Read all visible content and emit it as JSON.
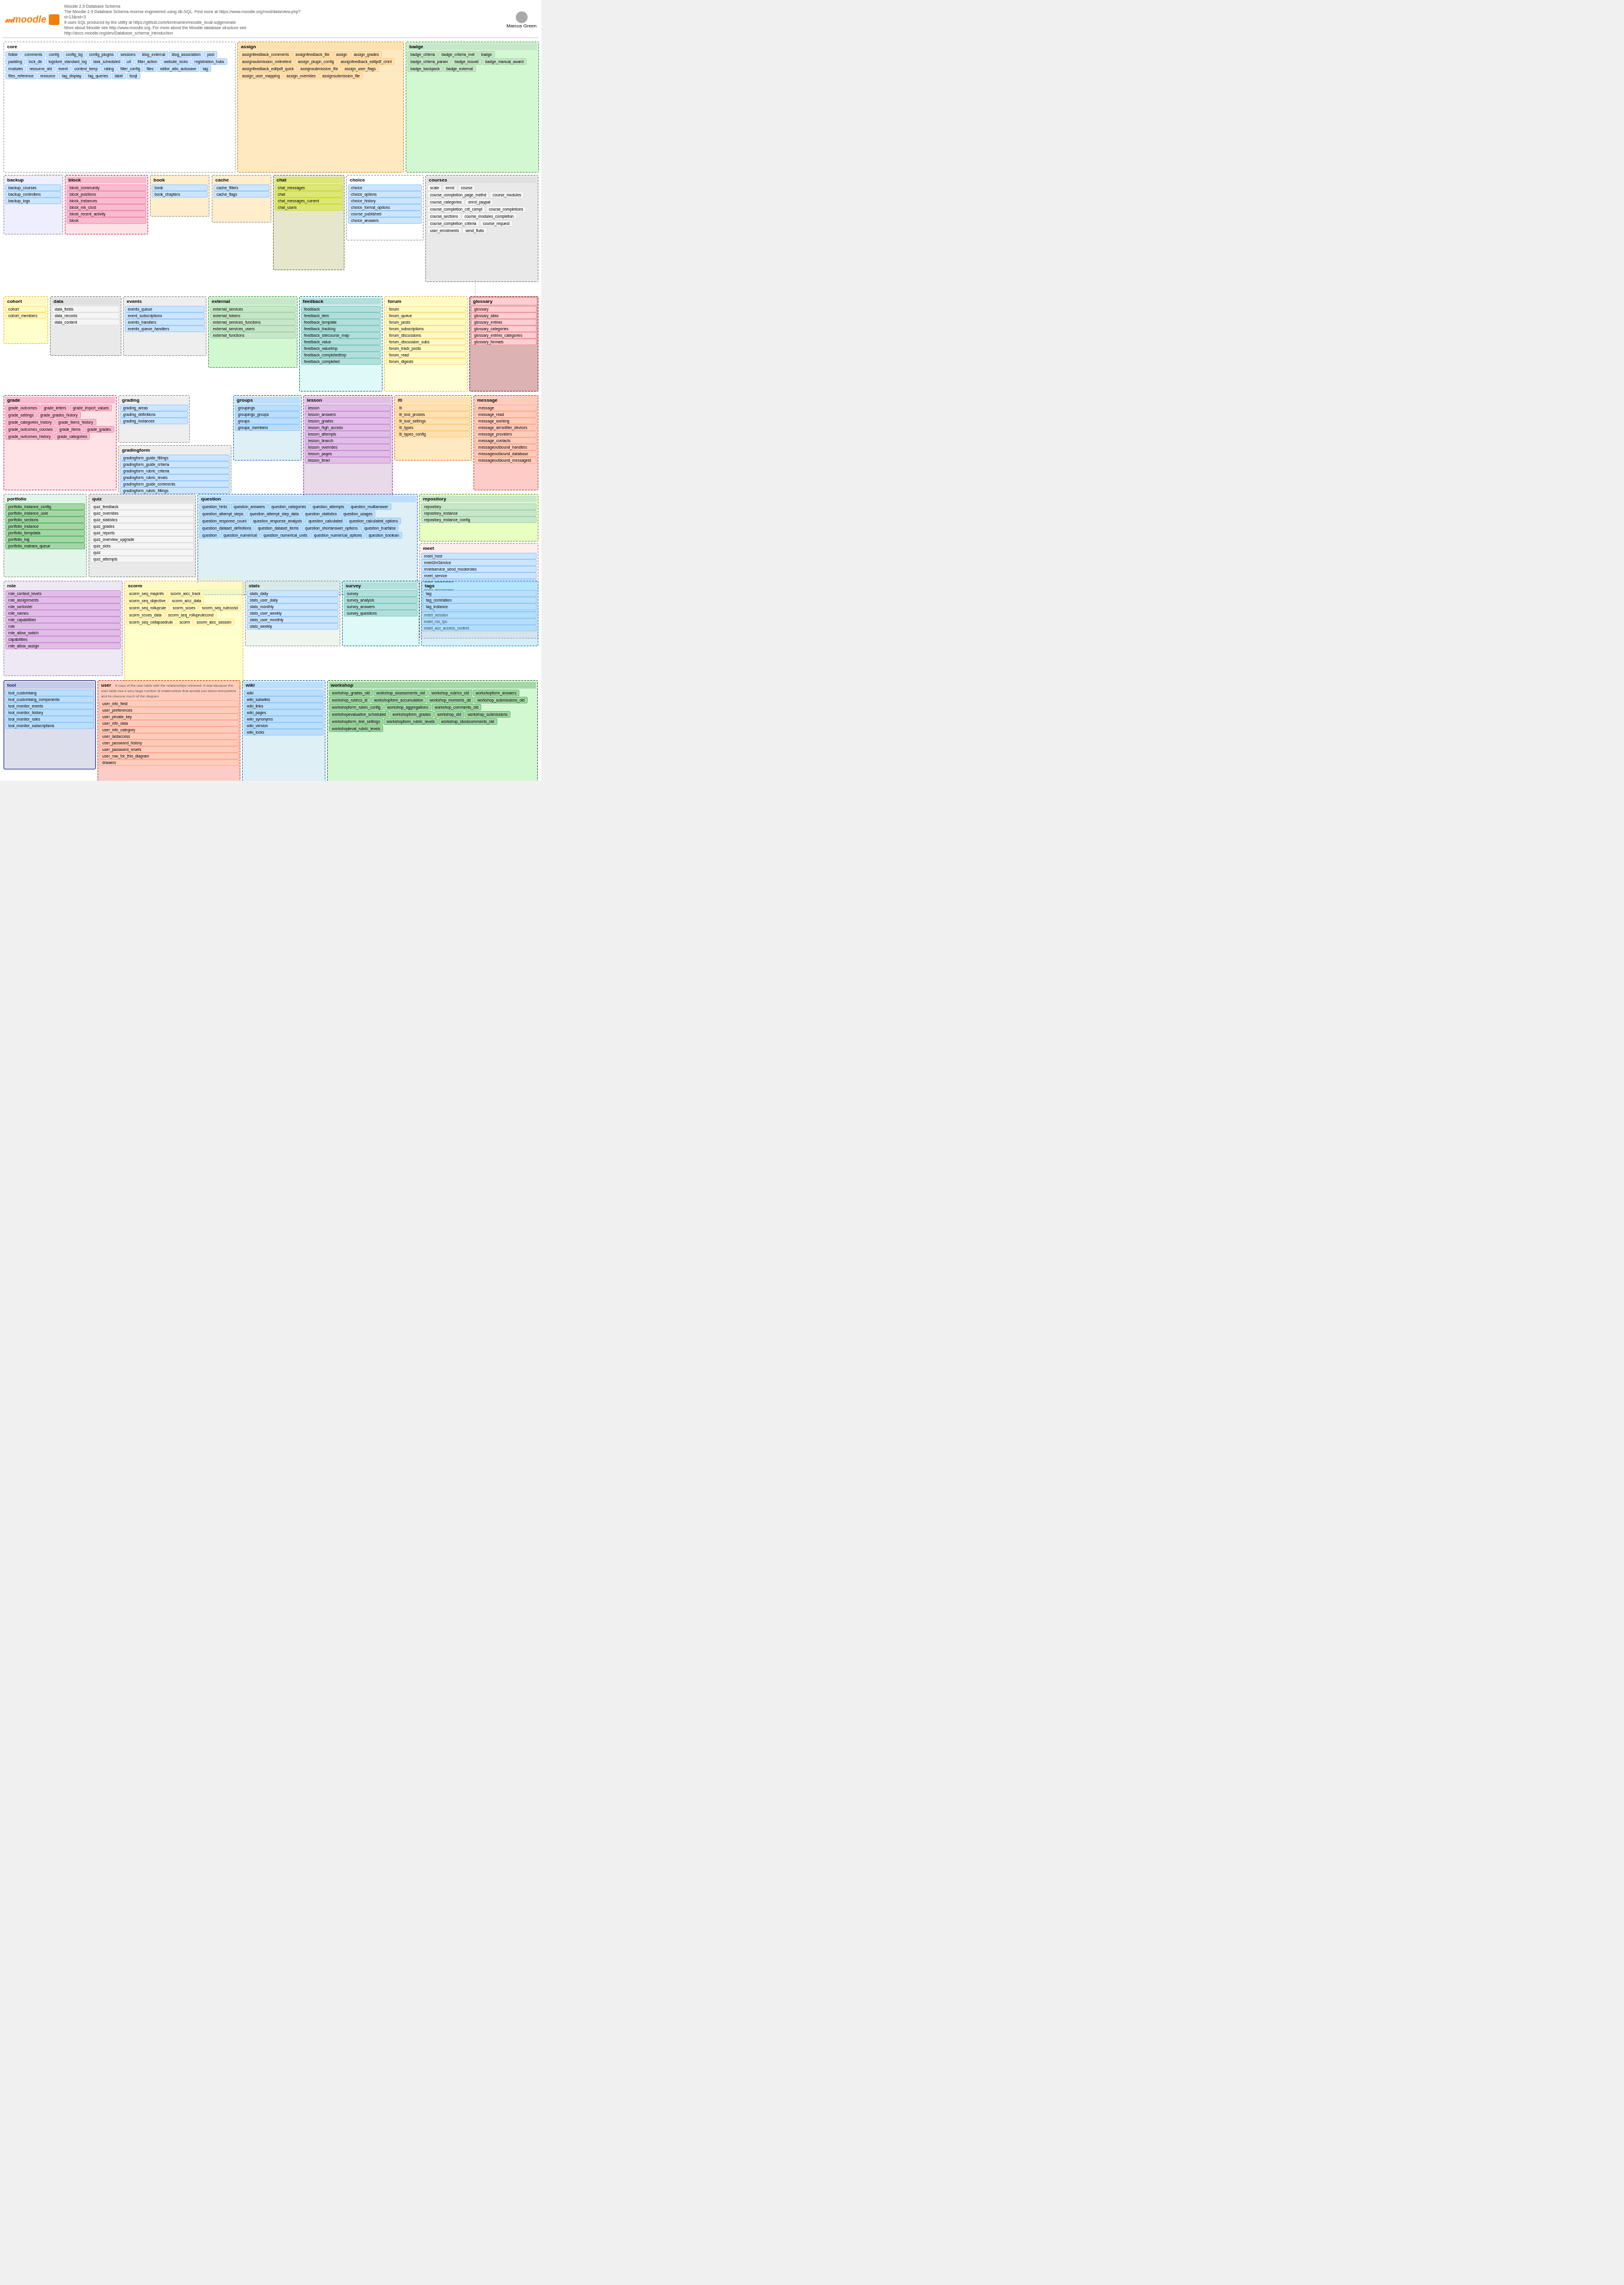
{
  "page": {
    "title": "Moodle 2.9 Database Schema",
    "subtitle": "Moodle Database Schema",
    "description": "The Moodle 2.9 Database Schema reverse engineered using db-SQL. Find more at https://www.moodle.org/mod/data/view.php?d=13&rid=3",
    "tool": "It uses SQL produced by the utility at https://github.com/tommarien/moodle_local-sqlgenerate",
    "moreinfo": "More about Moodle see http://www.moodle.org. For more about the Moodle database structure see http://docs.moodle.org/dev/Database_schema_introduction",
    "author": "Marcus Green"
  },
  "sections": {
    "core": {
      "label": "core",
      "tables": [
        "folder",
        "blog_external",
        "lock_db",
        "url",
        "resource_old",
        "rating",
        "tag",
        "tag_display",
        "tag_queries",
        "lssql"
      ],
      "subsections": [
        "comments",
        "config",
        "config_bg",
        "config_plugins",
        "sessions",
        "blog_association",
        "post",
        "padding",
        "logstore_standard_log",
        "task_scheduled",
        "filter_action",
        "website_locks",
        "registration_hubs",
        "modules",
        "event",
        "context_temp",
        "filter_config",
        "files",
        "editor_atto_autosave",
        "files_reference",
        "resource",
        "label"
      ]
    },
    "assign": {
      "label": "assign",
      "tables": [
        "assignfeedback_comments",
        "assignfeedback_file",
        "assign",
        "assign_grades",
        "assignsubmission_onlinetext",
        "assign_plugin_config",
        "assignfeedback_editpdf_cmnt",
        "assignfeedback_editpdf_quick",
        "assignsubmission_file",
        "assign_user_flags",
        "assign_user_mapping",
        "assign_overrides",
        "assignsubmission_file",
        "badge_criteria",
        "badge_criteria_met",
        "badge",
        "badge_criteria_param",
        "badge_issued",
        "badge_manual_award",
        "badge_backpack",
        "badge_external"
      ]
    },
    "backup": {
      "label": "backup",
      "tables": [
        "backup_courses",
        "backup_controllers",
        "backup_logs"
      ]
    },
    "block": {
      "label": "block",
      "tables": [
        "block_community",
        "block_positions",
        "block_instances",
        "block_mk_clost",
        "block_recent_activity",
        "block"
      ]
    },
    "book": {
      "label": "book",
      "tables": [
        "book",
        "book_chapters"
      ]
    },
    "cache": {
      "label": "cache",
      "tables": [
        "cache_filters",
        "cache_flags"
      ]
    },
    "chat": {
      "label": "chat",
      "tables": [
        "chat_messages",
        "chat",
        "chat_messages_current",
        "chat_users"
      ]
    },
    "choice": {
      "label": "choice",
      "tables": [
        "choice",
        "choice_options",
        "choice_history",
        "choice_format_options",
        "course_published",
        "choice_answers"
      ]
    },
    "courses": {
      "label": "courses",
      "tables": [
        "scale",
        "enrol",
        "course",
        "course_completion_page_methd",
        "course_modules",
        "course_categories",
        "enrol_paypal",
        "course_completion_crit_compl",
        "course_completions",
        "course_sections",
        "course_modules_completion",
        "course_completion_criteria",
        "course_request",
        "user_enrolments",
        "send_flutis"
      ]
    },
    "cohort": {
      "label": "cohort",
      "tables": [
        "cohort",
        "cohort_members"
      ]
    },
    "data": {
      "label": "data",
      "tables": [
        "data_fields",
        "data_records",
        "data_content"
      ]
    },
    "events": {
      "label": "events",
      "tables": [
        "events_queue",
        "event_subscriptions",
        "events_handlers",
        "events_queue_handlers"
      ]
    },
    "external": {
      "label": "external",
      "tables": [
        "external_services",
        "external_tokens",
        "external_services_functions",
        "external_services_users",
        "external_functions"
      ]
    },
    "feedback": {
      "label": "feedback",
      "tables": [
        "feedback",
        "feedback_item",
        "feedback_template",
        "feedback_tracking",
        "feedback_sitecourse_map",
        "feedback_value",
        "feedback_valuetmp",
        "feedback_completedtmp",
        "feedback_completed"
      ]
    },
    "forum": {
      "label": "forum",
      "tables": [
        "forum",
        "forum_queue",
        "forum_posts",
        "forum_subscriptions",
        "forum_discussions",
        "forum_discussion_subs",
        "forum_track_posts",
        "forum_read",
        "forum_digests"
      ]
    },
    "glossary": {
      "label": "glossary",
      "tables": [
        "glossary",
        "glossary_alias",
        "glossary_entries",
        "glossary_categories",
        "glossary_entries_categories",
        "glossary_formats"
      ]
    },
    "grade": {
      "label": "grade",
      "tables": [
        "grade_outcomes",
        "grade_letters",
        "grade_import_values",
        "grade_settings",
        "grade_grades_history",
        "grade_categories_history",
        "grade_items_history",
        "grade_outcomes_courses",
        "grade_items",
        "grade_grades",
        "grade_outcomes_history",
        "grade_categories"
      ]
    },
    "grading": {
      "label": "grading",
      "tables": [
        "grading_areas",
        "grading_definitions",
        "grading_instances"
      ]
    },
    "gradingform": {
      "label": "gradingform",
      "tables": [
        "gradingform_guide_fillings",
        "gradingform_guide_criteria",
        "gradingform_rubric_criteria",
        "gradingform_rubric_levels",
        "gradingform_guide_comments",
        "gradingform_rubric_fillings"
      ]
    },
    "groups": {
      "label": "groups",
      "tables": [
        "groupings",
        "groupings_groups",
        "groups",
        "groups_members"
      ]
    },
    "lesson": {
      "label": "lesson",
      "tables": [
        "lesson",
        "lesson_answers",
        "lesson_grades",
        "lesson_high_access",
        "lesson_attempts",
        "lesson_branch",
        "lesson_overrides",
        "lesson_pages",
        "lesson_timer"
      ]
    },
    "lti": {
      "label": "lti",
      "tables": [
        "lti",
        "lti_tool_proxies",
        "lti_tool_settings",
        "lti_types",
        "lti_types_config"
      ]
    },
    "message": {
      "label": "message",
      "tables": [
        "message",
        "message_read",
        "message_working",
        "message_airnotifier_devices",
        "message_providers",
        "message_contacts",
        "messageoutbound_handlers",
        "messageoutbound_database",
        "messageoutbound_messageid"
      ]
    },
    "meet": {
      "label": "meet",
      "tables": [
        "meet_host",
        "meet2mService",
        "mnetservice_send_mooleroles",
        "meet_service",
        "meet_application",
        "meet_serviceapp",
        "meet_log",
        "meet_module_resourcetype",
        "meet_rss",
        "meet_session",
        "meet_rss_tpc",
        "meet_acc_access_control"
      ]
    },
    "portfolio": {
      "label": "portfolio",
      "tables": [
        "portfolio_instance_config",
        "portfolio_instance_user",
        "portfolio_sections",
        "portfolio_instance",
        "portfolio_tempdata",
        "portfolio_log",
        "portfolio_mahara_queue"
      ]
    },
    "quiz": {
      "label": "quiz",
      "tables": [
        "quiz_feedback",
        "quiz_overrides",
        "quiz_statistics",
        "quiz_grades",
        "quiz_reports",
        "quiz_overview_upgrade",
        "quiz_slots",
        "quiz_attempts"
      ]
    },
    "question": {
      "label": "question",
      "tables": [
        "question_hints",
        "question_answers",
        "question_categories",
        "question_attempts",
        "question_multianswer",
        "question_attempt_steps",
        "question_attempt_step_data",
        "question_statistics",
        "question_usages",
        "question_response_count",
        "question_response_analysis",
        "question_calculated",
        "question_calculated_options",
        "question_dataset_definitions",
        "question_dataset_items",
        "question_dataset_items",
        "question_shortanswer_options",
        "question_truefalse",
        "question",
        "question_numerical",
        "question_numerical_units",
        "question_numerical_options",
        "question_boolean"
      ]
    },
    "repository": {
      "label": "repository",
      "tables": [
        "repository",
        "repository_instance",
        "repository_instance_config"
      ]
    },
    "role": {
      "label": "role",
      "tables": [
        "role_context_levels",
        "role_assignments",
        "role_sortorder",
        "role_names",
        "role_capabilities",
        "role",
        "role_allow_switch",
        "capabilities",
        "role_allow_assign"
      ]
    },
    "scorm": {
      "label": "scorm",
      "tables": [
        "scorm_seq_mapinfo",
        "scorm_aicc_track",
        "scorm_seq_objective",
        "scorm_aicc_data",
        "scorm_seq_rolluprule",
        "scorm_scoes",
        "scorm_seq_rulecond",
        "scorm_scoes_data",
        "scorm_seq_rolluprulecond",
        "scorm_seq_collapsedrule",
        "scorm",
        "scorm_aicc_session"
      ]
    },
    "stats": {
      "label": "stats",
      "tables": [
        "stats_daily",
        "stats_user_daily",
        "stats_monthly",
        "stats_user_weekly",
        "stats_user_monthly",
        "stats_weekly"
      ]
    },
    "survey": {
      "label": "survey",
      "tables": [
        "survey",
        "survey_analysis",
        "survey_answers",
        "survey_questions"
      ]
    },
    "tags": {
      "label": "tags",
      "tables": [
        "tag",
        "tag_correlation",
        "tag_instance"
      ]
    },
    "tool": {
      "label": "tool",
      "tables": [
        "tool_customlang",
        "tool_customlang_components",
        "tool_monitor_events",
        "tool_monitor_history",
        "tool_monitor_rules",
        "tool_monitor_subscriptions"
      ]
    },
    "user": {
      "label": "user",
      "tables": [
        "user_info_field",
        "user_preferences",
        "user_private_key",
        "user_info_data",
        "user_info_category",
        "user_lastaccess",
        "user_password_history",
        "user_password_resets",
        "drawers"
      ]
    },
    "wiki": {
      "label": "wiki",
      "tables": [
        "wiki",
        "wiki_subwikis",
        "wiki_links",
        "wiki_pages",
        "wiki_synonyms",
        "wiki_version",
        "wiki_locks"
      ]
    },
    "workshop": {
      "label": "workshop",
      "tables": [
        "workshop_grades_old",
        "workshop_assessments_old",
        "workshop_rubrics_old",
        "workshopform_answers",
        "workshop_rubrics_id",
        "workshopform_accumulation",
        "workshop_moments_dd",
        "workshop_submissions_old",
        "workshopform_rubric_config",
        "workshop_aggregations",
        "workshop_comments_old",
        "workshopevaluation_scheduled",
        "workshopform_grades",
        "workshop_old",
        "workshopform_answers",
        "workshop_submissions",
        "workshopform_test_settings",
        "workshopform_rubric_levels",
        "workshop_stockcomments_old",
        "workshopleval_rubric_levels"
      ]
    }
  }
}
